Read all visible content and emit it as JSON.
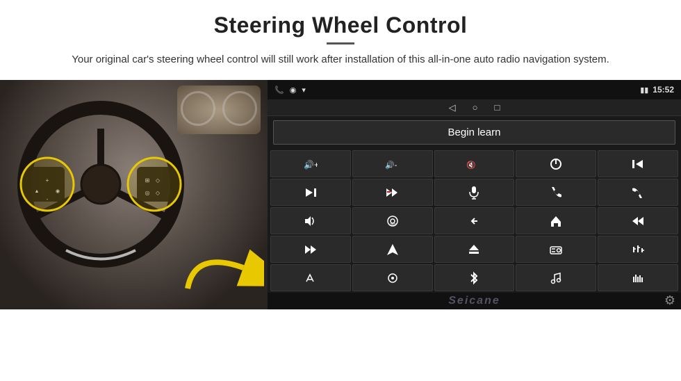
{
  "header": {
    "title": "Steering Wheel Control",
    "subtitle": "Your original car's steering wheel control will still work after installation of this all-in-one auto radio navigation system."
  },
  "android_screen": {
    "statusbar": {
      "time": "15:52",
      "icons": [
        "◁",
        "○",
        "□"
      ]
    },
    "begin_learn_label": "Begin learn",
    "watermark": "Seicane",
    "controls": [
      {
        "icon": "🔊+",
        "label": "vol-up"
      },
      {
        "icon": "🔊-",
        "label": "vol-down"
      },
      {
        "icon": "🔇",
        "label": "mute"
      },
      {
        "icon": "⏻",
        "label": "power"
      },
      {
        "icon": "⏮",
        "label": "prev-track"
      },
      {
        "icon": "⏭",
        "label": "next"
      },
      {
        "icon": "✂⏭",
        "label": "next-chapter"
      },
      {
        "icon": "🎤",
        "label": "mic"
      },
      {
        "icon": "📞",
        "label": "phone"
      },
      {
        "icon": "📞↩",
        "label": "hang-up"
      },
      {
        "icon": "🔊",
        "label": "speaker"
      },
      {
        "icon": "360°",
        "label": "camera"
      },
      {
        "icon": "↩",
        "label": "back"
      },
      {
        "icon": "🏠",
        "label": "home"
      },
      {
        "icon": "⏮⏮",
        "label": "rewind"
      },
      {
        "icon": "⏭⏭",
        "label": "fast-forward"
      },
      {
        "icon": "▶",
        "label": "navigate"
      },
      {
        "icon": "⏏",
        "label": "eject"
      },
      {
        "icon": "📻",
        "label": "radio"
      },
      {
        "icon": "⚙",
        "label": "eq"
      },
      {
        "icon": "✏",
        "label": "learn"
      },
      {
        "icon": "⊙",
        "label": "settings2"
      },
      {
        "icon": "✱",
        "label": "bluetooth"
      },
      {
        "icon": "🎵",
        "label": "music"
      },
      {
        "icon": "▓",
        "label": "eq2"
      }
    ]
  }
}
